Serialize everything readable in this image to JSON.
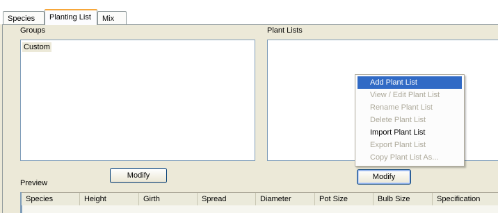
{
  "tabs": [
    {
      "label": "Species",
      "active": false
    },
    {
      "label": "Planting List",
      "active": true
    },
    {
      "label": "Mix",
      "active": false
    }
  ],
  "groups": {
    "label": "Groups",
    "items": [
      "Custom"
    ],
    "modify_label": "Modify"
  },
  "plant_lists": {
    "label": "Plant Lists",
    "items": [],
    "modify_label": "Modify"
  },
  "context_menu": {
    "items": [
      {
        "label": "Add Plant List",
        "enabled": true,
        "highlighted": true
      },
      {
        "label": "View / Edit Plant List",
        "enabled": false,
        "highlighted": false
      },
      {
        "label": "Rename Plant List",
        "enabled": false,
        "highlighted": false
      },
      {
        "label": "Delete Plant List",
        "enabled": false,
        "highlighted": false
      },
      {
        "label": "Import Plant List",
        "enabled": true,
        "highlighted": false
      },
      {
        "label": "Export Plant List",
        "enabled": false,
        "highlighted": false
      },
      {
        "label": "Copy Plant List As...",
        "enabled": false,
        "highlighted": false
      }
    ]
  },
  "preview": {
    "label": "Preview",
    "columns": [
      "Species",
      "Height",
      "Girth",
      "Spread",
      "Diameter",
      "Pot Size",
      "Bulb Size",
      "Specification"
    ]
  },
  "colors": {
    "panel": "#ece9d8",
    "tab_accent": "#f7a73a",
    "menu_highlight": "#316ac5",
    "disabled_text": "#aca899"
  }
}
